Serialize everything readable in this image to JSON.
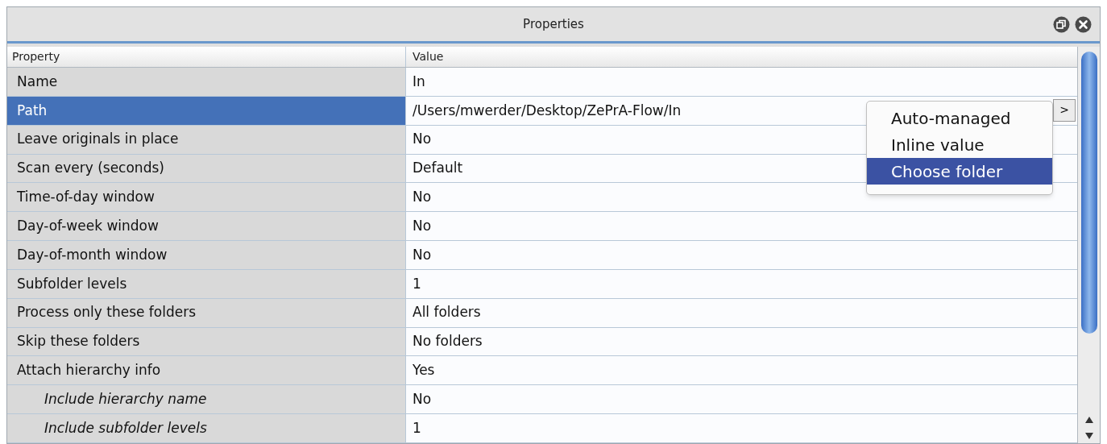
{
  "window": {
    "title": "Properties"
  },
  "table": {
    "columns": [
      "Property",
      "Value"
    ],
    "rows": [
      {
        "property": "Name",
        "value": "In",
        "selected": false
      },
      {
        "property": "Path",
        "value": "/Users/mwerder/Desktop/ZePrA-Flow/In",
        "selected": true,
        "button": ">"
      },
      {
        "property": "Leave originals in place",
        "value": "No",
        "selected": false
      },
      {
        "property": "Scan every (seconds)",
        "value": "Default",
        "selected": false
      },
      {
        "property": "Time-of-day window",
        "value": "No",
        "selected": false
      },
      {
        "property": "Day-of-week window",
        "value": "No",
        "selected": false
      },
      {
        "property": "Day-of-month window",
        "value": "No",
        "selected": false
      },
      {
        "property": "Subfolder levels",
        "value": "1",
        "selected": false
      },
      {
        "property": "Process only these folders",
        "value": "All folders",
        "selected": false
      },
      {
        "property": "Skip these folders",
        "value": "No folders",
        "selected": false
      },
      {
        "property": "Attach hierarchy info",
        "value": "Yes",
        "selected": false,
        "children": [
          {
            "property": "Include hierarchy name",
            "value": "No",
            "selected": false
          },
          {
            "property": "Include subfolder levels",
            "value": "1",
            "selected": false
          }
        ]
      }
    ]
  },
  "menu": {
    "items": [
      {
        "label": "Auto-managed",
        "selected": false
      },
      {
        "label": "Inline value",
        "selected": false
      },
      {
        "label": "Choose folder",
        "selected": true
      }
    ]
  }
}
